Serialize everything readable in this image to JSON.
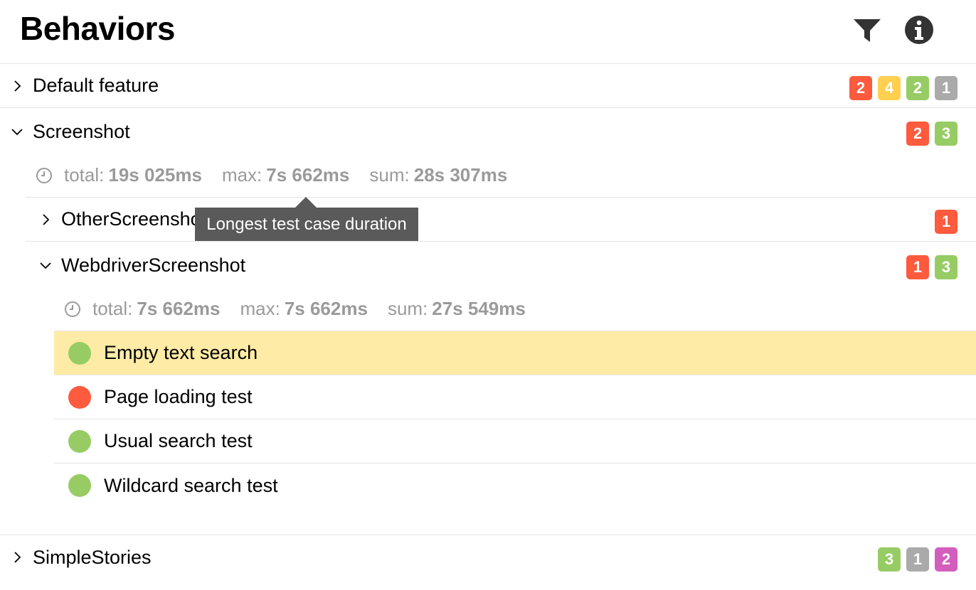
{
  "header": {
    "title": "Behaviors",
    "filter_icon": "filter-icon",
    "info_icon": "info-icon"
  },
  "colors": {
    "failed": "#fd5a3e",
    "broken": "#ffd050",
    "passed": "#97cc64",
    "skipped": "#aaaaaa",
    "unknown": "#d35ebe",
    "selected_row": "#feeba6",
    "tooltip_bg": "#5a5a5a"
  },
  "tree": {
    "default_feature": {
      "label": "Default feature",
      "expanded": false,
      "badges": [
        "2",
        "4",
        "2",
        "1"
      ]
    },
    "screenshot": {
      "label": "Screenshot",
      "expanded": true,
      "badges": [
        "2",
        "3"
      ],
      "stats": {
        "total_label": "total:",
        "total_value": "19s 025ms",
        "max_label": "max:",
        "max_value": "7s 662ms",
        "sum_label": "sum:",
        "sum_value": "28s 307ms"
      },
      "other_screenshot": {
        "label": "OtherScreenshot",
        "expanded": false,
        "badges": [
          "1"
        ]
      },
      "webdriver_screenshot": {
        "label": "WebdriverScreenshot",
        "expanded": true,
        "badges": [
          "1",
          "3"
        ],
        "stats": {
          "total_label": "total:",
          "total_value": "7s 662ms",
          "max_label": "max:",
          "max_value": "7s 662ms",
          "sum_label": "sum:",
          "sum_value": "27s 549ms"
        },
        "cases": [
          {
            "name": "Empty text search",
            "status": "passed",
            "selected": true
          },
          {
            "name": "Page loading test",
            "status": "failed",
            "selected": false
          },
          {
            "name": "Usual search test",
            "status": "passed",
            "selected": false
          },
          {
            "name": "Wildcard search test",
            "status": "passed",
            "selected": false
          }
        ]
      }
    },
    "simple_stories": {
      "label": "SimpleStories",
      "expanded": false,
      "badges": [
        "3",
        "1",
        "2"
      ]
    }
  },
  "tooltip": {
    "text": "Longest test case duration"
  }
}
